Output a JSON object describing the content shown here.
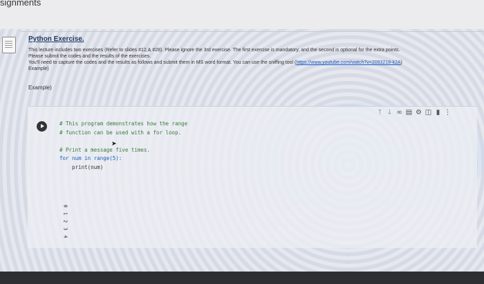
{
  "page": {
    "title": "signments"
  },
  "exercise": {
    "title": "Python Exercise.",
    "instructions": [
      "This lecture includes two exercises (Refer to slides #12,& #28). Please ignore the 3rd exercise. The first exercise is mandatory, and the second is optional for the extra points.",
      "Please submit the codes and the results of the exercises.",
      "You'll need to capture the codes and the results as follows and submit them in MS word format. You can use the sniffing tool (",
      "Example)"
    ],
    "link_text": "https://www.youtube.com/watch?v=2093218-k2A",
    "link_suffix": ")",
    "example_label": "Example)"
  },
  "cell": {
    "code_lines": [
      {
        "cls": "cm",
        "text": "# This program demonstrates how the range"
      },
      {
        "cls": "cm",
        "text": "# function can be used with a for loop."
      },
      {
        "cls": "",
        "text": ""
      },
      {
        "cls": "cm",
        "text": "# Print a message five times."
      },
      {
        "cls": "kw",
        "text": "for num in range(5):"
      },
      {
        "cls": "fn",
        "text": "    print(num)"
      }
    ],
    "output": [
      "0",
      "1",
      "2",
      "3",
      "4"
    ]
  },
  "toolbar_icons": [
    {
      "name": "move-up-icon",
      "glyph": "↑"
    },
    {
      "name": "move-down-icon",
      "glyph": "↓"
    },
    {
      "name": "link-icon",
      "glyph": "∞"
    },
    {
      "name": "comment-icon",
      "glyph": "▤"
    },
    {
      "name": "settings-icon",
      "glyph": "⚙"
    },
    {
      "name": "mirror-cell-icon",
      "glyph": "◫"
    },
    {
      "name": "delete-icon",
      "glyph": "▮"
    },
    {
      "name": "more-options-icon",
      "glyph": "⋮"
    }
  ]
}
